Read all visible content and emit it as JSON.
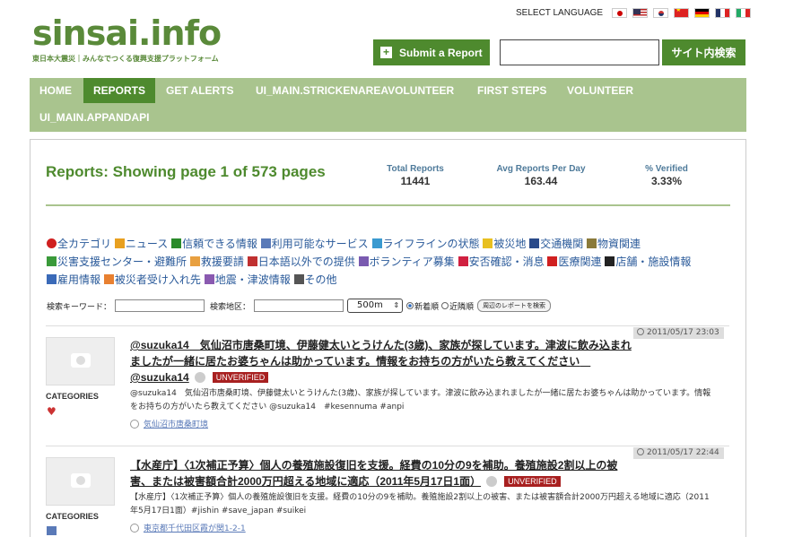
{
  "logo": {
    "text_main": "sinsai",
    "text_dot": ".",
    "text_tld": "info",
    "subtitle": "東日本大震災｜みんなでつくる復興支援プラットフォーム"
  },
  "language": {
    "label": "SELECT LANGUAGE"
  },
  "header": {
    "submit_label": "Submit a Report",
    "search_value": "",
    "search_button": "サイト内検索"
  },
  "nav": [
    {
      "label": "HOME",
      "active": false
    },
    {
      "label": "REPORTS",
      "active": true
    },
    {
      "label": "GET ALERTS",
      "active": false
    },
    {
      "label": "UI_MAIN.STRICKENAREAVOLUNTEER",
      "active": false
    },
    {
      "label": "FIRST STEPS",
      "active": false
    },
    {
      "label": "VOLUNTEER",
      "active": false
    },
    {
      "label": "UI_MAIN.APPANDAPI",
      "active": false
    }
  ],
  "reports": {
    "title": "Reports: Showing page 1 of 573 pages",
    "stats": [
      {
        "label": "Total Reports",
        "value": "11441"
      },
      {
        "label": "Avg Reports Per Day",
        "value": "163.44"
      },
      {
        "label": "% Verified",
        "value": "3.33%"
      }
    ]
  },
  "categories": [
    {
      "label": "全カテゴリ",
      "color": "#d02020"
    },
    {
      "label": "ニュース",
      "color": "#e8a020"
    },
    {
      "label": "信頼できる情報",
      "color": "#2a8a2a"
    },
    {
      "label": "利用可能なサービス",
      "color": "#5a7ab8"
    },
    {
      "label": "ライフラインの状態",
      "color": "#3a9ad0"
    },
    {
      "label": "被災地",
      "color": "#e8c020"
    },
    {
      "label": "交通機関",
      "color": "#2a4a8a"
    },
    {
      "label": "物資関連",
      "color": "#8a7a3a"
    },
    {
      "label": "災害支援センター・避難所",
      "color": "#3a9a3a"
    },
    {
      "label": "救援要請",
      "color": "#e8a040"
    },
    {
      "label": "日本語以外での提供",
      "color": "#c03030"
    },
    {
      "label": "ボランティア募集",
      "color": "#7a5ab0"
    },
    {
      "label": "安否確認・消息",
      "color": "#d02040"
    },
    {
      "label": "医療関連",
      "color": "#d02020"
    },
    {
      "label": "店舗・施設情報",
      "color": "#222222"
    },
    {
      "label": "雇用情報",
      "color": "#3a6ab8"
    },
    {
      "label": "被災者受け入れ先",
      "color": "#e88030"
    },
    {
      "label": "地震・津波情報",
      "color": "#8a5ab0"
    },
    {
      "label": "その他",
      "color": "#555555"
    }
  ],
  "filters": {
    "keyword_label": "検索キーワード：",
    "area_label": "検索地区：",
    "distance": "500m",
    "sort_new": "新着順",
    "sort_near": "近隣順",
    "nearby_button": "周辺のレポートを検索"
  },
  "report_items": [
    {
      "date": "2011/05/17 23:03",
      "title": "@suzuka14　気仙沼市唐桑町境、伊藤健太いとうけんた(3歳)、家族が探しています。津波に飲み込まれましたが一緒に居たお婆ちゃんは助かっています。情報をお持ちの方がいたら教えてください　@suzuka14",
      "status": "UNVERIFIED",
      "categories_label": "CATEGORIES",
      "description": "@suzuka14　気仙沼市唐桑町境、伊藤健太いとうけんた(3歳)、家族が探しています。津波に飲み込まれましたが一緒に居たお婆ちゃんは助かっています。情報をお持ちの方がいたら教えてください @suzuka14　#kesennuma #anpi",
      "location": "気仙沼市唐桑町境"
    },
    {
      "date": "2011/05/17 22:44",
      "title": "【水産庁】〈1次補正予算〉個人の養殖施設復旧を支援。経費の10分の9を補助。養殖施設2割以上の被害、または被害額合計2000万円超える地域に適応（2011年5月17日1面）",
      "status": "UNVERIFIED",
      "categories_label": "CATEGORIES",
      "description": "【水産庁】〈1次補正予算〉個人の養殖施設復旧を支援。経費の10分の9を補助。養殖施設2割以上の被害、または被害額合計2000万円超える地域に適応（2011年5月17日1面）#jishin #save_japan #suikei",
      "location": "東京都千代田区霞が関1-2-1"
    }
  ]
}
